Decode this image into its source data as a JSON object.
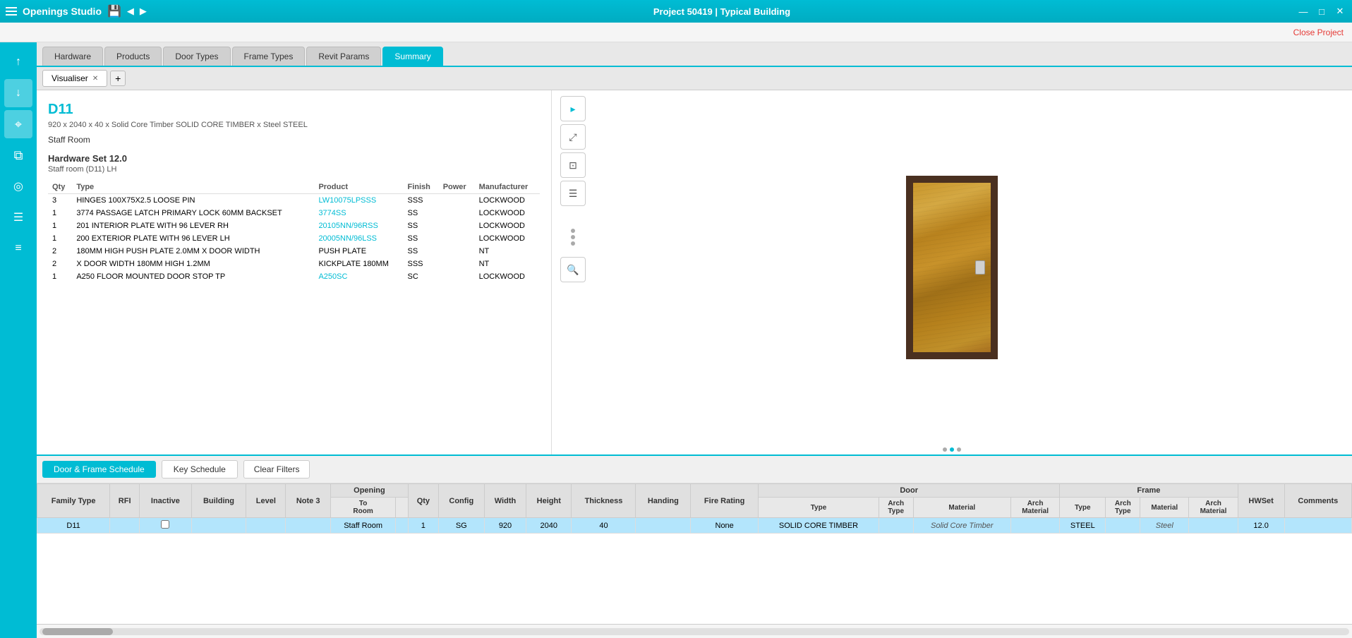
{
  "titlebar": {
    "app_name": "Openings Studio",
    "project_title": "Project 50419 | Typical Building",
    "close_project_label": "Close Project"
  },
  "tabs": [
    {
      "id": "hardware",
      "label": "Hardware",
      "active": false
    },
    {
      "id": "products",
      "label": "Products",
      "active": false
    },
    {
      "id": "door-types",
      "label": "Door Types",
      "active": false
    },
    {
      "id": "frame-types",
      "label": "Frame Types",
      "active": false
    },
    {
      "id": "revit-params",
      "label": "Revit Params",
      "active": false
    },
    {
      "id": "summary",
      "label": "Summary",
      "active": true
    }
  ],
  "visualiser_tab": {
    "label": "Visualiser",
    "add_label": "+"
  },
  "door_detail": {
    "door_id": "D11",
    "description": "920 x 2040 x 40 x Solid Core Timber SOLID CORE TIMBER x Steel STEEL",
    "room": "Staff Room",
    "hardware_set_title": "Hardware Set 12.0",
    "hardware_set_subtitle": "Staff room (D11) LH",
    "hardware_table_headers": [
      "Qty",
      "Type",
      "Product",
      "Finish",
      "Power",
      "Manufacturer"
    ],
    "hardware_items": [
      {
        "qty": "3",
        "type": "HINGES 100X75X2.5 LOOSE PIN",
        "product": "LW10075LPSSS",
        "product_link": true,
        "finish": "SSS",
        "power": "",
        "manufacturer": "LOCKWOOD"
      },
      {
        "qty": "1",
        "type": "3774 PASSAGE LATCH PRIMARY LOCK 60MM BACKSET",
        "product": "3774SS",
        "product_link": true,
        "finish": "SS",
        "power": "",
        "manufacturer": "LOCKWOOD"
      },
      {
        "qty": "1",
        "type": "201 INTERIOR PLATE WITH 96 LEVER RH",
        "product": "20105NN/96RSS",
        "product_link": true,
        "finish": "SS",
        "power": "",
        "manufacturer": "LOCKWOOD"
      },
      {
        "qty": "1",
        "type": "200 EXTERIOR PLATE WITH 96 LEVER LH",
        "product": "20005NN/96LSS",
        "product_link": true,
        "finish": "SS",
        "power": "",
        "manufacturer": "LOCKWOOD"
      },
      {
        "qty": "2",
        "type": "180MM HIGH PUSH PLATE 2.0MM X DOOR WIDTH",
        "product": "PUSH PLATE",
        "product_link": false,
        "finish": "SS",
        "power": "",
        "manufacturer": "NT"
      },
      {
        "qty": "2",
        "type": "X DOOR WIDTH 180MM HIGH 1.2MM",
        "product": "KICKPLATE 180MM",
        "product_link": false,
        "finish": "SSS",
        "power": "",
        "manufacturer": "NT"
      },
      {
        "qty": "1",
        "type": "A250 FLOOR MOUNTED DOOR STOP TP",
        "product": "A250SC",
        "product_link": true,
        "finish": "SC",
        "power": "",
        "manufacturer": "LOCKWOOD"
      }
    ]
  },
  "schedule": {
    "tab_active": "Door & Frame Schedule",
    "tab_inactive": "Key Schedule",
    "clear_filters": "Clear Filters",
    "col_groups": [
      {
        "label": "",
        "colspan": 1
      },
      {
        "label": "Opening",
        "colspan": 7
      },
      {
        "label": "Door",
        "colspan": 5
      },
      {
        "label": "Frame",
        "colspan": 6
      },
      {
        "label": "",
        "colspan": 2
      }
    ],
    "columns": [
      "Family Type",
      "RFI",
      "Inactive",
      "Building",
      "Level",
      "Note 3",
      "To Room",
      "Qty",
      "Config",
      "Width",
      "Height",
      "Thickness",
      "Handing",
      "Fire Rating",
      "Type",
      "Arch Type",
      "Material",
      "Arch Material",
      "Type",
      "Arch Type",
      "Material",
      "Arch Material",
      "HWSet",
      "Comments"
    ],
    "rows": [
      {
        "family_type": "D11",
        "rfi": "",
        "inactive": "",
        "building": "",
        "level": "",
        "note3": "",
        "to_room": "Staff Room",
        "qty": "1",
        "config": "SG",
        "width": "920",
        "height": "2040",
        "thickness": "40",
        "handing": "",
        "fire_rating": "None",
        "door_type": "SOLID CORE TIMBER",
        "door_arch_type": "",
        "door_material": "Solid Core Timber",
        "door_arch_material": "",
        "frame_type": "STEEL",
        "frame_arch_type": "",
        "frame_material": "Steel",
        "frame_arch_material": "",
        "hwset": "12.0",
        "comments": "",
        "selected": true
      }
    ]
  },
  "sidebar_icons": [
    {
      "id": "arrow-up",
      "symbol": "↑"
    },
    {
      "id": "arrow-down",
      "symbol": "↓"
    },
    {
      "id": "cursor",
      "symbol": "⌖"
    },
    {
      "id": "copy",
      "symbol": "⧉"
    },
    {
      "id": "globe",
      "symbol": "◎"
    },
    {
      "id": "list",
      "symbol": "☰"
    },
    {
      "id": "lines",
      "symbol": "≡"
    }
  ]
}
